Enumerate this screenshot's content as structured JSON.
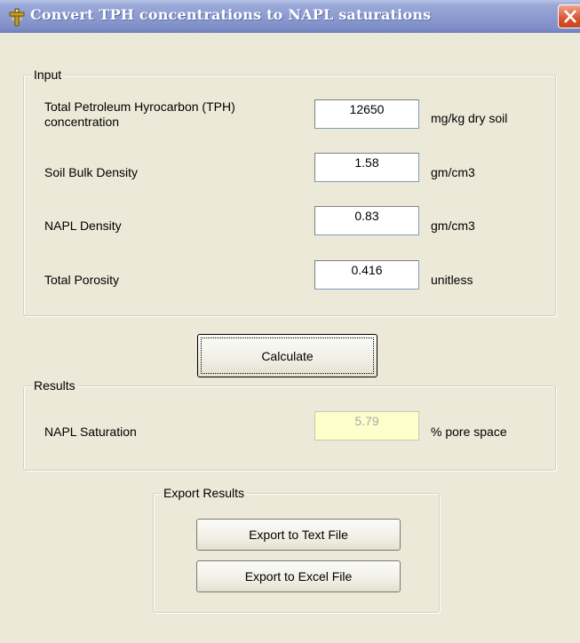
{
  "window": {
    "title": "Convert TPH concentrations to NAPL saturations"
  },
  "input": {
    "legend": "Input",
    "rows": [
      {
        "label_line1": "Total Petroleum Hyrocarbon (TPH)",
        "label_line2": "concentration",
        "value": "12650",
        "unit": "mg/kg dry soil"
      },
      {
        "label_line1": "Soil Bulk Density",
        "value": "1.58",
        "unit": "gm/cm3"
      },
      {
        "label_line1": "NAPL Density",
        "value": "0.83",
        "unit": "gm/cm3"
      },
      {
        "label_line1": "Total Porosity",
        "value": "0.416",
        "unit": "unitless"
      }
    ]
  },
  "calculate_label": "Calculate",
  "results": {
    "legend": "Results",
    "label": "NAPL Saturation",
    "value": "5.79",
    "unit": "% pore space"
  },
  "export": {
    "legend": "Export Results",
    "text_label": "Export to Text File",
    "excel_label": "Export to Excel File"
  },
  "colors": {
    "titlebar": "#8d9bd0",
    "dialog_bg": "#ece9d8",
    "readonly_field": "#ffffcc",
    "close_button": "#d9542f"
  },
  "icons": {
    "title": "app-cross-icon",
    "close": "close-x-icon"
  }
}
